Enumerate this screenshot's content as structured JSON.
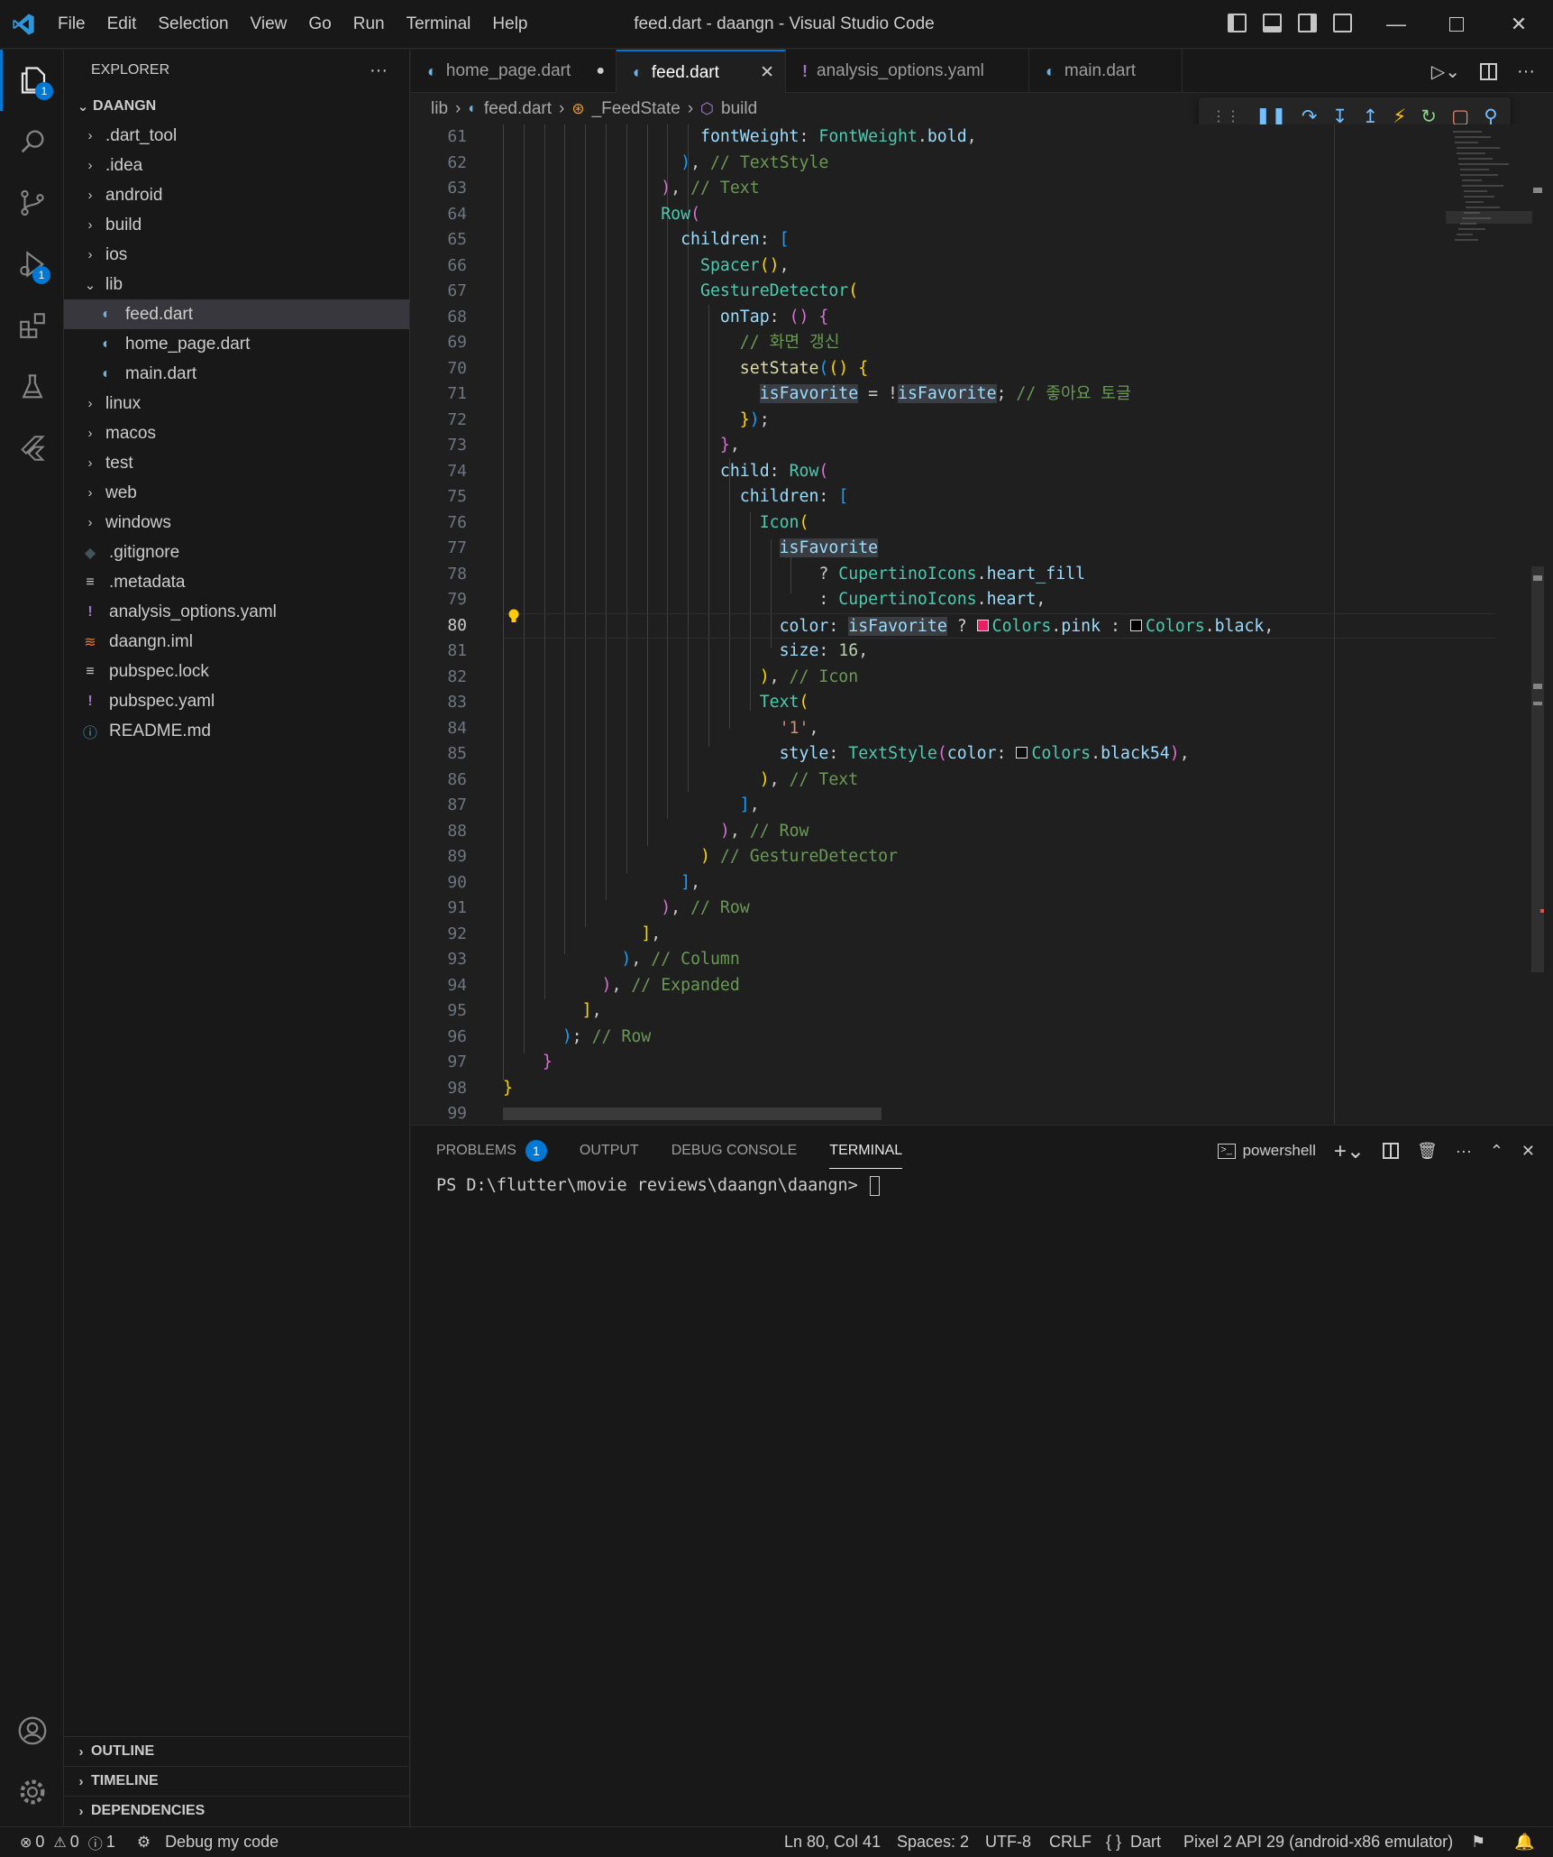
{
  "window": {
    "title": "feed.dart - daangn - Visual Studio Code",
    "menu": [
      "File",
      "Edit",
      "Selection",
      "View",
      "Go",
      "Run",
      "Terminal",
      "Help"
    ]
  },
  "activity_bar": {
    "explorer_badge": "1",
    "debug_badge": "1"
  },
  "sidebar": {
    "header": "EXPLORER",
    "more": "···",
    "root": "DAANGN",
    "items": [
      {
        "label": ".dart_tool",
        "type": "folder",
        "depth": 1
      },
      {
        "label": ".idea",
        "type": "folder",
        "depth": 1
      },
      {
        "label": "android",
        "type": "folder",
        "depth": 1
      },
      {
        "label": "build",
        "type": "folder",
        "depth": 1
      },
      {
        "label": "ios",
        "type": "folder",
        "depth": 1
      },
      {
        "label": "lib",
        "type": "folder-open",
        "depth": 1
      },
      {
        "label": "feed.dart",
        "type": "dart",
        "depth": 2,
        "selected": true
      },
      {
        "label": "home_page.dart",
        "type": "dart",
        "depth": 2
      },
      {
        "label": "main.dart",
        "type": "dart",
        "depth": 2
      },
      {
        "label": "linux",
        "type": "folder",
        "depth": 1
      },
      {
        "label": "macos",
        "type": "folder",
        "depth": 1
      },
      {
        "label": "test",
        "type": "folder",
        "depth": 1
      },
      {
        "label": "web",
        "type": "folder",
        "depth": 1
      },
      {
        "label": "windows",
        "type": "folder",
        "depth": 1
      },
      {
        "label": ".gitignore",
        "type": "git",
        "depth": 1
      },
      {
        "label": ".metadata",
        "type": "lines",
        "depth": 1
      },
      {
        "label": "analysis_options.yaml",
        "type": "yaml",
        "depth": 1
      },
      {
        "label": "daangn.iml",
        "type": "rss",
        "depth": 1
      },
      {
        "label": "pubspec.lock",
        "type": "lines",
        "depth": 1
      },
      {
        "label": "pubspec.yaml",
        "type": "yaml",
        "depth": 1
      },
      {
        "label": "README.md",
        "type": "info",
        "depth": 1
      }
    ],
    "sections": [
      "OUTLINE",
      "TIMELINE",
      "DEPENDENCIES"
    ]
  },
  "tabs": [
    {
      "label": "home_page.dart",
      "modified": true
    },
    {
      "label": "feed.dart",
      "active": true
    },
    {
      "label": "analysis_options.yaml"
    },
    {
      "label": "main.dart"
    }
  ],
  "breadcrumb": [
    "lib",
    "feed.dart",
    "_FeedState",
    "build"
  ],
  "editor": {
    "line_numbers": [
      "61",
      "62",
      "63",
      "64",
      "65",
      "66",
      "67",
      "68",
      "69",
      "70",
      "71",
      "72",
      "73",
      "74",
      "75",
      "76",
      "77",
      "78",
      "79",
      "80",
      "81",
      "82",
      "83",
      "84",
      "85",
      "86",
      "87",
      "88",
      "89",
      "90",
      "91",
      "92",
      "93",
      "94",
      "95",
      "96",
      "97",
      "98",
      "99"
    ],
    "current_line": "80"
  },
  "panel": {
    "tabs": [
      "PROBLEMS",
      "OUTPUT",
      "DEBUG CONSOLE",
      "TERMINAL"
    ],
    "problems_count": "1",
    "shell": "powershell",
    "terminal_prompt": "PS D:\\flutter\\movie reviews\\daangn\\daangn> "
  },
  "status": {
    "errors": "0",
    "warnings": "0",
    "infos": "1",
    "launch": "Debug my code",
    "position": "Ln 80, Col 41",
    "spaces": "Spaces: 2",
    "encoding": "UTF-8",
    "eol": "CRLF",
    "language": "Dart",
    "device": "Pixel 2 API 29 (android-x86 emulator)"
  },
  "colors": {
    "accent": "#0078d4",
    "background": "#1f1f1f",
    "sidebar": "#181818"
  }
}
